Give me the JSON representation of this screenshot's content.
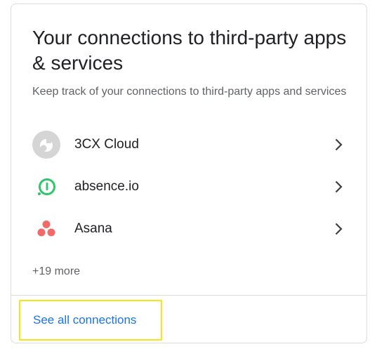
{
  "card": {
    "title": "Your connections to third-party apps & services",
    "subtitle": "Keep track of your connections to third-party apps and services",
    "apps": [
      {
        "name": "3CX Cloud",
        "icon": "3cx-logo-icon"
      },
      {
        "name": "absence.io",
        "icon": "absence-io-logo-icon"
      },
      {
        "name": "Asana",
        "icon": "asana-logo-icon"
      }
    ],
    "more_label": "+19 more",
    "see_all_label": "See all connections"
  },
  "colors": {
    "title": "#202124",
    "secondary_text": "#5f6368",
    "link": "#1a73e8",
    "border": "#dadce0",
    "highlight": "#f9e31c",
    "absence_green": "#2fc56b",
    "asana_coral": "#f06a6a"
  }
}
